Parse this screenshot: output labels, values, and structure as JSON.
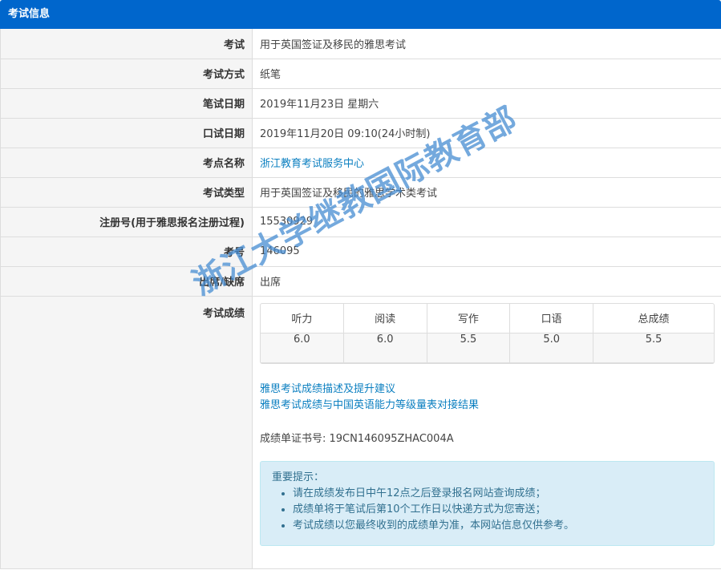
{
  "header": {
    "title": "考试信息"
  },
  "rows": [
    {
      "label": "考试",
      "value": "用于英国签证及移民的雅思考试"
    },
    {
      "label": "考试方式",
      "value": "纸笔"
    },
    {
      "label": "笔试日期",
      "value": "2019年11月23日 星期六"
    },
    {
      "label": "口试日期",
      "value": "2019年11月20日 09:10(24小时制)"
    },
    {
      "label": "考点名称",
      "value": "浙江教育考试服务中心"
    },
    {
      "label": "考试类型",
      "value": "用于英国签证及移民的雅思学术类考试"
    },
    {
      "label": "注册号(用于雅思报名注册过程)",
      "value": "15530929"
    },
    {
      "label": "考号",
      "value": "146095"
    },
    {
      "label": "出席/缺席",
      "value": "出席"
    }
  ],
  "scores": {
    "label": "考试成绩",
    "headers": [
      "听力",
      "阅读",
      "写作",
      "口语",
      "总成绩"
    ],
    "values": [
      "6.0",
      "6.0",
      "5.5",
      "5.0",
      "5.5"
    ]
  },
  "links": {
    "description": "雅思考试成绩描述及提升建议",
    "mapping": "雅思考试成绩与中国英语能力等级量表对接结果"
  },
  "certificate": "成绩单证书号: 19CN146095ZHAC004A",
  "notice": {
    "title": "重要提示：",
    "items": [
      "请在成绩发布日中午12点之后登录报名网站查询成绩；",
      "成绩单将于笔试后第10个工作日以快递方式为您寄送；",
      "考试成绩以您最终收到的成绩单为准，本网站信息仅供参考。"
    ]
  },
  "watermark": "浙江大学继教国际教育部",
  "colors": {
    "header_bg": "#0066cc",
    "link": "#0b7fc0",
    "notice_bg": "#d9edf7",
    "notice_text": "#31708f",
    "watermark": "#468cd2"
  }
}
